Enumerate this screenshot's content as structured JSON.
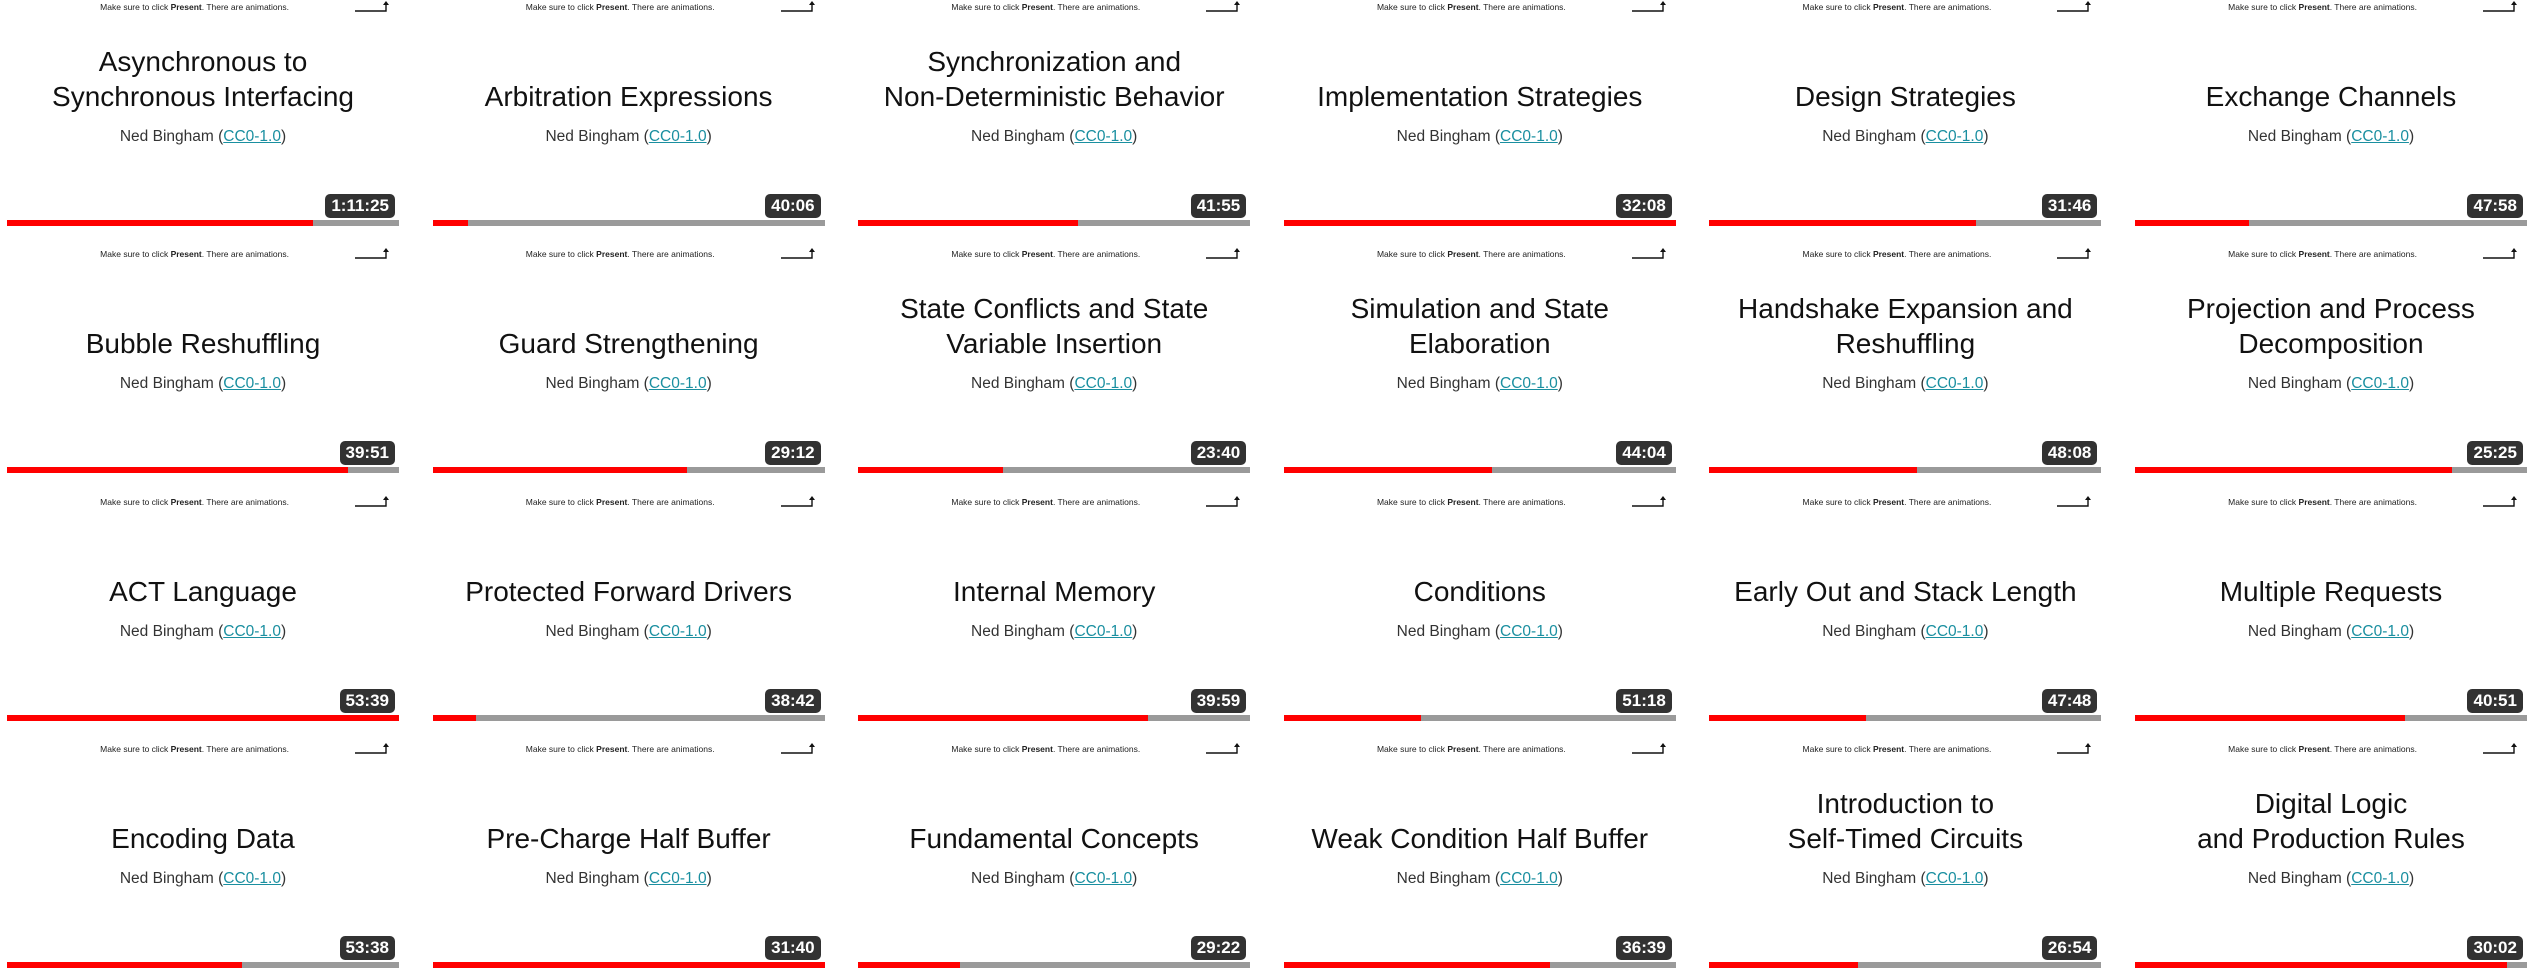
{
  "notice": {
    "prefix": "Make sure to click ",
    "bold": "Present",
    "suffix": ". There are animations."
  },
  "author": {
    "name": "Ned Bingham",
    "open_paren": " (",
    "license": "CC0-1.0",
    "close_paren": ")"
  },
  "colors": {
    "progress": "#ff0000",
    "track": "#9a9a9a",
    "link": "#1a8fa0",
    "badge_bg": "#1c1c1c"
  },
  "icons": {
    "corner_arrow": "corner-up-arrow-icon"
  },
  "videos": [
    {
      "title": "Asynchronous to\nSynchronous Interfacing",
      "duration": "1:11:25",
      "watched": 0.78
    },
    {
      "title": "Arbitration Expressions",
      "duration": "40:06",
      "watched": 0.09
    },
    {
      "title": "Synchronization and\nNon-Deterministic Behavior",
      "duration": "41:55",
      "watched": 0.56
    },
    {
      "title": "Implementation Strategies",
      "duration": "32:08",
      "watched": 1.0
    },
    {
      "title": "Design Strategies",
      "duration": "31:46",
      "watched": 0.68
    },
    {
      "title": "Exchange Channels",
      "duration": "47:58",
      "watched": 0.29
    },
    {
      "title": "Bubble Reshuffling",
      "duration": "39:51",
      "watched": 0.87
    },
    {
      "title": "Guard Strengthening",
      "duration": "29:12",
      "watched": 0.65
    },
    {
      "title": "State Conflicts and State\nVariable Insertion",
      "duration": "23:40",
      "watched": 0.37
    },
    {
      "title": "Simulation and State\nElaboration",
      "duration": "44:04",
      "watched": 0.53
    },
    {
      "title": "Handshake Expansion and\nReshuffling",
      "duration": "48:08",
      "watched": 0.53
    },
    {
      "title": "Projection and Process\nDecomposition",
      "duration": "25:25",
      "watched": 0.81
    },
    {
      "title": "ACT Language",
      "duration": "53:39",
      "watched": 1.0
    },
    {
      "title": "Protected Forward Drivers",
      "duration": "38:42",
      "watched": 0.11
    },
    {
      "title": "Internal Memory",
      "duration": "39:59",
      "watched": 0.74
    },
    {
      "title": "Conditions",
      "duration": "51:18",
      "watched": 0.35
    },
    {
      "title": "Early Out and Stack Length",
      "duration": "47:48",
      "watched": 0.4
    },
    {
      "title": "Multiple Requests",
      "duration": "40:51",
      "watched": 0.69
    },
    {
      "title": "Encoding Data",
      "duration": "53:38",
      "watched": 0.6
    },
    {
      "title": "Pre-Charge Half Buffer",
      "duration": "31:40",
      "watched": 1.0
    },
    {
      "title": "Fundamental Concepts",
      "duration": "29:22",
      "watched": 0.26
    },
    {
      "title": "Weak Condition Half Buffer",
      "duration": "36:39",
      "watched": 0.68
    },
    {
      "title": "Introduction to\nSelf-Timed Circuits",
      "duration": "26:54",
      "watched": 0.38
    },
    {
      "title": "Digital Logic\nand Production Rules",
      "duration": "30:02",
      "watched": 0.95
    }
  ]
}
